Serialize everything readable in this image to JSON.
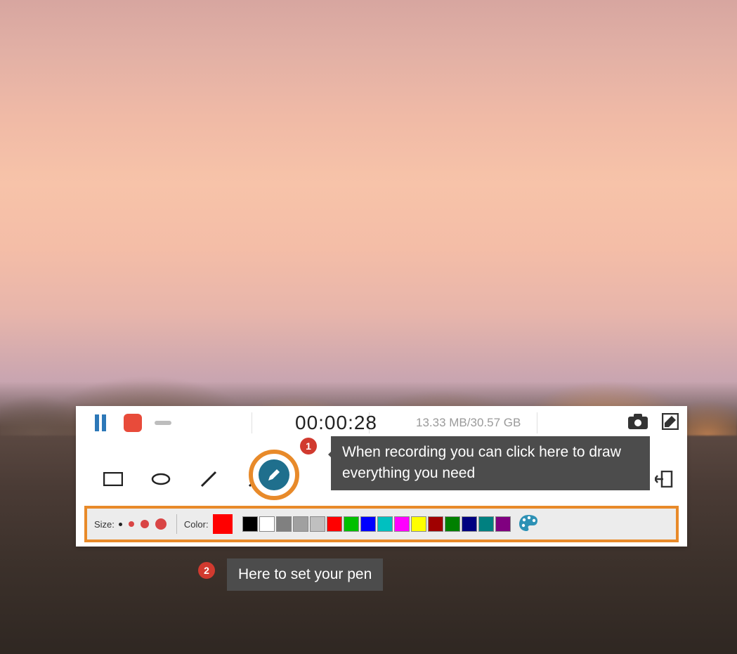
{
  "recorder": {
    "timer": "00:00:28",
    "storage": "13.33 MB/30.57 GB"
  },
  "options": {
    "size_label": "Size:",
    "color_label": "Color:",
    "current_color": "#ff0000",
    "swatches": [
      "#000000",
      "#ffffff",
      "#808080",
      "#a0a0a0",
      "#c0c0c0",
      "#ff0000",
      "#00c000",
      "#0000ff",
      "#00c0c0",
      "#ff00ff",
      "#ffff00",
      "#a00000",
      "#008000",
      "#000080",
      "#008080",
      "#800080"
    ]
  },
  "annotations": {
    "badge1": "1",
    "tip1": "When recording you can click here to draw everything you need",
    "badge2": "2",
    "tip2": "Here to set your pen"
  }
}
